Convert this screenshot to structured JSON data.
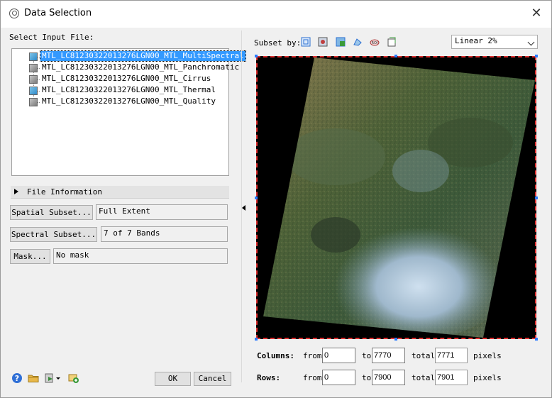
{
  "window": {
    "title": "Data Selection",
    "close_glyph": "✕"
  },
  "input": {
    "label": "Select Input File:",
    "files": [
      {
        "name": "MTL_LC81230322013276LGN00_MTL_MultiSpectral",
        "icon": "color-raster-icon",
        "selected": true
      },
      {
        "name": "MTL_LC81230322013276LGN00_MTL_Panchromatic",
        "icon": "gray-raster-icon",
        "selected": false
      },
      {
        "name": "MTL_LC81230322013276LGN00_MTL_Cirrus",
        "icon": "gray-raster-icon",
        "selected": false
      },
      {
        "name": "MTL_LC81230322013276LGN00_MTL_Thermal",
        "icon": "color-raster-icon",
        "selected": false
      },
      {
        "name": "MTL_LC81230322013276LGN00_MTL_Quality",
        "icon": "gray-raster-icon",
        "selected": false
      }
    ]
  },
  "file_info": {
    "label": "File Information"
  },
  "subsets": {
    "spatial_label": "Spatial Subset...",
    "spatial_value": "Full Extent",
    "spectral_label": "Spectral Subset...",
    "spectral_value": "7 of 7 Bands",
    "mask_label": "Mask...",
    "mask_value": "No mask"
  },
  "footer": {
    "ok_label": "OK",
    "cancel_label": "Cancel"
  },
  "preview": {
    "subset_by_label": "Subset by:",
    "stretch_value": "Linear 2%",
    "columns_label": "Columns:",
    "rows_label": "Rows:",
    "from_label": "from",
    "to_label": "to",
    "total_label": "total",
    "pixels_label": "pixels",
    "columns": {
      "from": "0",
      "to": "7770",
      "total": "7771"
    },
    "rows": {
      "from": "0",
      "to": "7900",
      "total": "7901"
    }
  }
}
